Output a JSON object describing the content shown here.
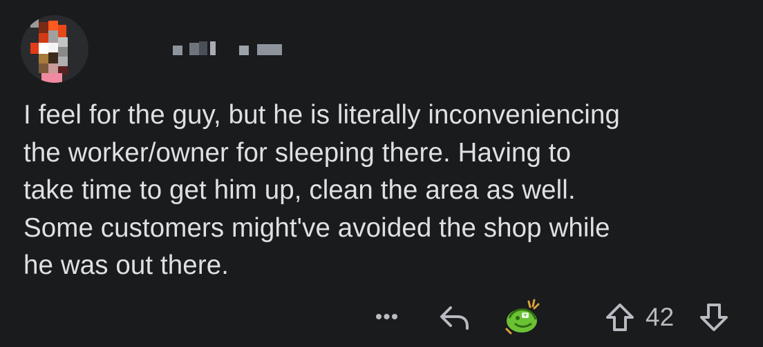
{
  "comment": {
    "username": "",
    "body_lines": [
      "I feel for the guy, but he is literally inconveniencing",
      "the worker/owner for sleeping there. Having to",
      "take time to get him up, clean the area as well.",
      "Some customers might've avoided the shop while",
      "he was out there."
    ],
    "score": "42"
  },
  "actions": {
    "more_label": "•••",
    "icons": {
      "more": "more-options-icon",
      "reply": "reply-arrow-icon",
      "award": "award-icon",
      "upvote": "upvote-arrow-icon",
      "downvote": "downvote-arrow-icon"
    }
  },
  "colors": {
    "background": "#1a1b1d",
    "text": "#dfe0e2",
    "icon": "#b8bcc1",
    "award_green": "#6bc234"
  }
}
